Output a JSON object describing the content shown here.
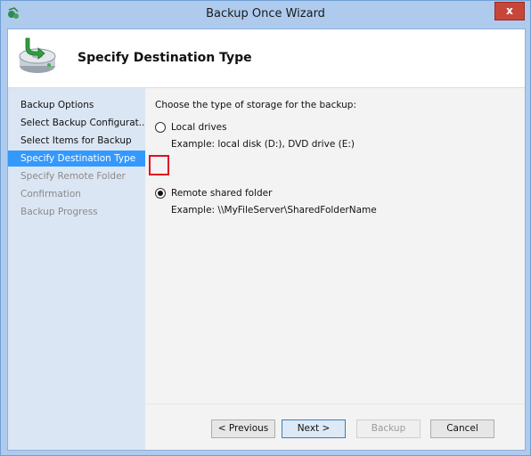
{
  "window": {
    "title": "Backup Once Wizard",
    "close_label": "x"
  },
  "header": {
    "title": "Specify Destination Type"
  },
  "sidebar": {
    "items": [
      {
        "label": "Backup Options",
        "state": "normal"
      },
      {
        "label": "Select Backup Configurat...",
        "state": "normal"
      },
      {
        "label": "Select Items for Backup",
        "state": "normal"
      },
      {
        "label": "Specify Destination Type",
        "state": "selected"
      },
      {
        "label": "Specify Remote Folder",
        "state": "disabled"
      },
      {
        "label": "Confirmation",
        "state": "disabled"
      },
      {
        "label": "Backup Progress",
        "state": "disabled"
      }
    ]
  },
  "main": {
    "prompt": "Choose the type of storage for the backup:",
    "options": [
      {
        "label": "Local drives",
        "example": "Example: local disk (D:), DVD drive (E:)",
        "checked": false
      },
      {
        "label": "Remote shared folder",
        "example": "Example: \\\\MyFileServer\\SharedFolderName",
        "checked": true
      }
    ]
  },
  "buttons": {
    "previous": "< Previous",
    "next": "Next >",
    "backup": "Backup",
    "cancel": "Cancel"
  },
  "colors": {
    "title_bar": "#aecbee",
    "close_button": "#c7463a",
    "sidebar_bg": "#dbe6f4",
    "selected_item": "#3399ff",
    "content_bg": "#f3f3f3",
    "highlight_box": "#e01020"
  }
}
